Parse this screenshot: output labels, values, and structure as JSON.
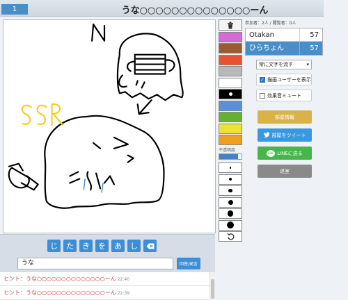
{
  "header": {
    "round": "1",
    "title": "うな○○○○○○○○○○○○○○ーん"
  },
  "tools": {
    "trash_icon": "trash-icon",
    "colors": [
      "#d46ad8",
      "#9a5b32",
      "#e8532f",
      "#b8b8b8",
      "#ffffff",
      "#000000",
      "#5b8fd8",
      "#66b030",
      "#f0e030",
      "#f0a020"
    ],
    "opacity_label": "不透明度",
    "opacity_value": 0.85,
    "brush_sizes": [
      1,
      2,
      3,
      4,
      5,
      6
    ],
    "undo_icon": "undo-icon"
  },
  "room": {
    "counts": "参加者：2人 / 閲覧者：0人",
    "players": [
      {
        "name": "Otakan",
        "score": "57"
      },
      {
        "name": "ひらちょん",
        "score": "57"
      }
    ],
    "scroll_select": "常に文字を流す",
    "show_drawer_label": "描画ユーザーを表示",
    "show_drawer_checked": true,
    "mute_label": "効果音ミュート",
    "mute_checked": false,
    "room_info_button": "部屋情報",
    "tweet_button": "部屋をツイート",
    "line_button": "LINEに送る",
    "exit_button": "退室"
  },
  "input": {
    "kana": [
      "じ",
      "た",
      "き",
      "を",
      "あ",
      "し"
    ],
    "backspace_icon": "backspace-icon",
    "message_value": "うな",
    "send_button": "回答/発言"
  },
  "chat": [
    {
      "text": "ヒント：うな○○○○○○○○○○○○○○ーん",
      "time": "22:40"
    },
    {
      "text": "ヒント：うな○○○○○○○○○○○○○○ーん",
      "time": "22:39"
    }
  ]
}
